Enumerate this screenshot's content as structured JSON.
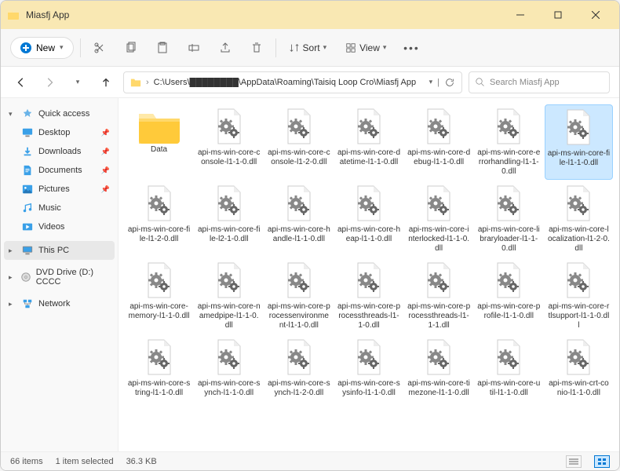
{
  "window": {
    "title": "Miasfj App"
  },
  "toolbar": {
    "new_label": "New",
    "sort_label": "Sort",
    "view_label": "View"
  },
  "address": {
    "path": "C:\\Users\\████████\\AppData\\Roaming\\Taisiq Loop Cro\\Miasfj App"
  },
  "search": {
    "placeholder": "Search Miasfj App"
  },
  "sidebar": {
    "quick_access": "Quick access",
    "desktop": "Desktop",
    "downloads": "Downloads",
    "documents": "Documents",
    "pictures": "Pictures",
    "music": "Music",
    "videos": "Videos",
    "this_pc": "This PC",
    "dvd": "DVD Drive (D:) CCCC",
    "network": "Network"
  },
  "files": {
    "folder": "Data",
    "items": [
      "api-ms-win-core-console-l1-1-0.dll",
      "api-ms-win-core-console-l1-2-0.dll",
      "api-ms-win-core-datetime-l1-1-0.dll",
      "api-ms-win-core-debug-l1-1-0.dll",
      "api-ms-win-core-errorhandling-l1-1-0.dll",
      "api-ms-win-core-file-l1-1-0.dll",
      "api-ms-win-core-file-l1-2-0.dll",
      "api-ms-win-core-file-l2-1-0.dll",
      "api-ms-win-core-handle-l1-1-0.dll",
      "api-ms-win-core-heap-l1-1-0.dll",
      "api-ms-win-core-interlocked-l1-1-0.dll",
      "api-ms-win-core-libraryloader-l1-1-0.dll",
      "api-ms-win-core-localization-l1-2-0.dll",
      "api-ms-win-core-memory-l1-1-0.dll",
      "api-ms-win-core-namedpipe-l1-1-0.dll",
      "api-ms-win-core-processenvironment-l1-1-0.dll",
      "api-ms-win-core-processthreads-l1-1-0.dll",
      "api-ms-win-core-processthreads-l1-1-1.dll",
      "api-ms-win-core-profile-l1-1-0.dll",
      "api-ms-win-core-rtlsupport-l1-1-0.dll",
      "api-ms-win-core-string-l1-1-0.dll",
      "api-ms-win-core-synch-l1-1-0.dll",
      "api-ms-win-core-synch-l1-2-0.dll",
      "api-ms-win-core-sysinfo-l1-1-0.dll",
      "api-ms-win-core-timezone-l1-1-0.dll",
      "api-ms-win-core-util-l1-1-0.dll",
      "api-ms-win-crt-conio-l1-1-0.dll"
    ]
  },
  "status": {
    "count": "66 items",
    "selected": "1 item selected",
    "size": "36.3 KB"
  }
}
